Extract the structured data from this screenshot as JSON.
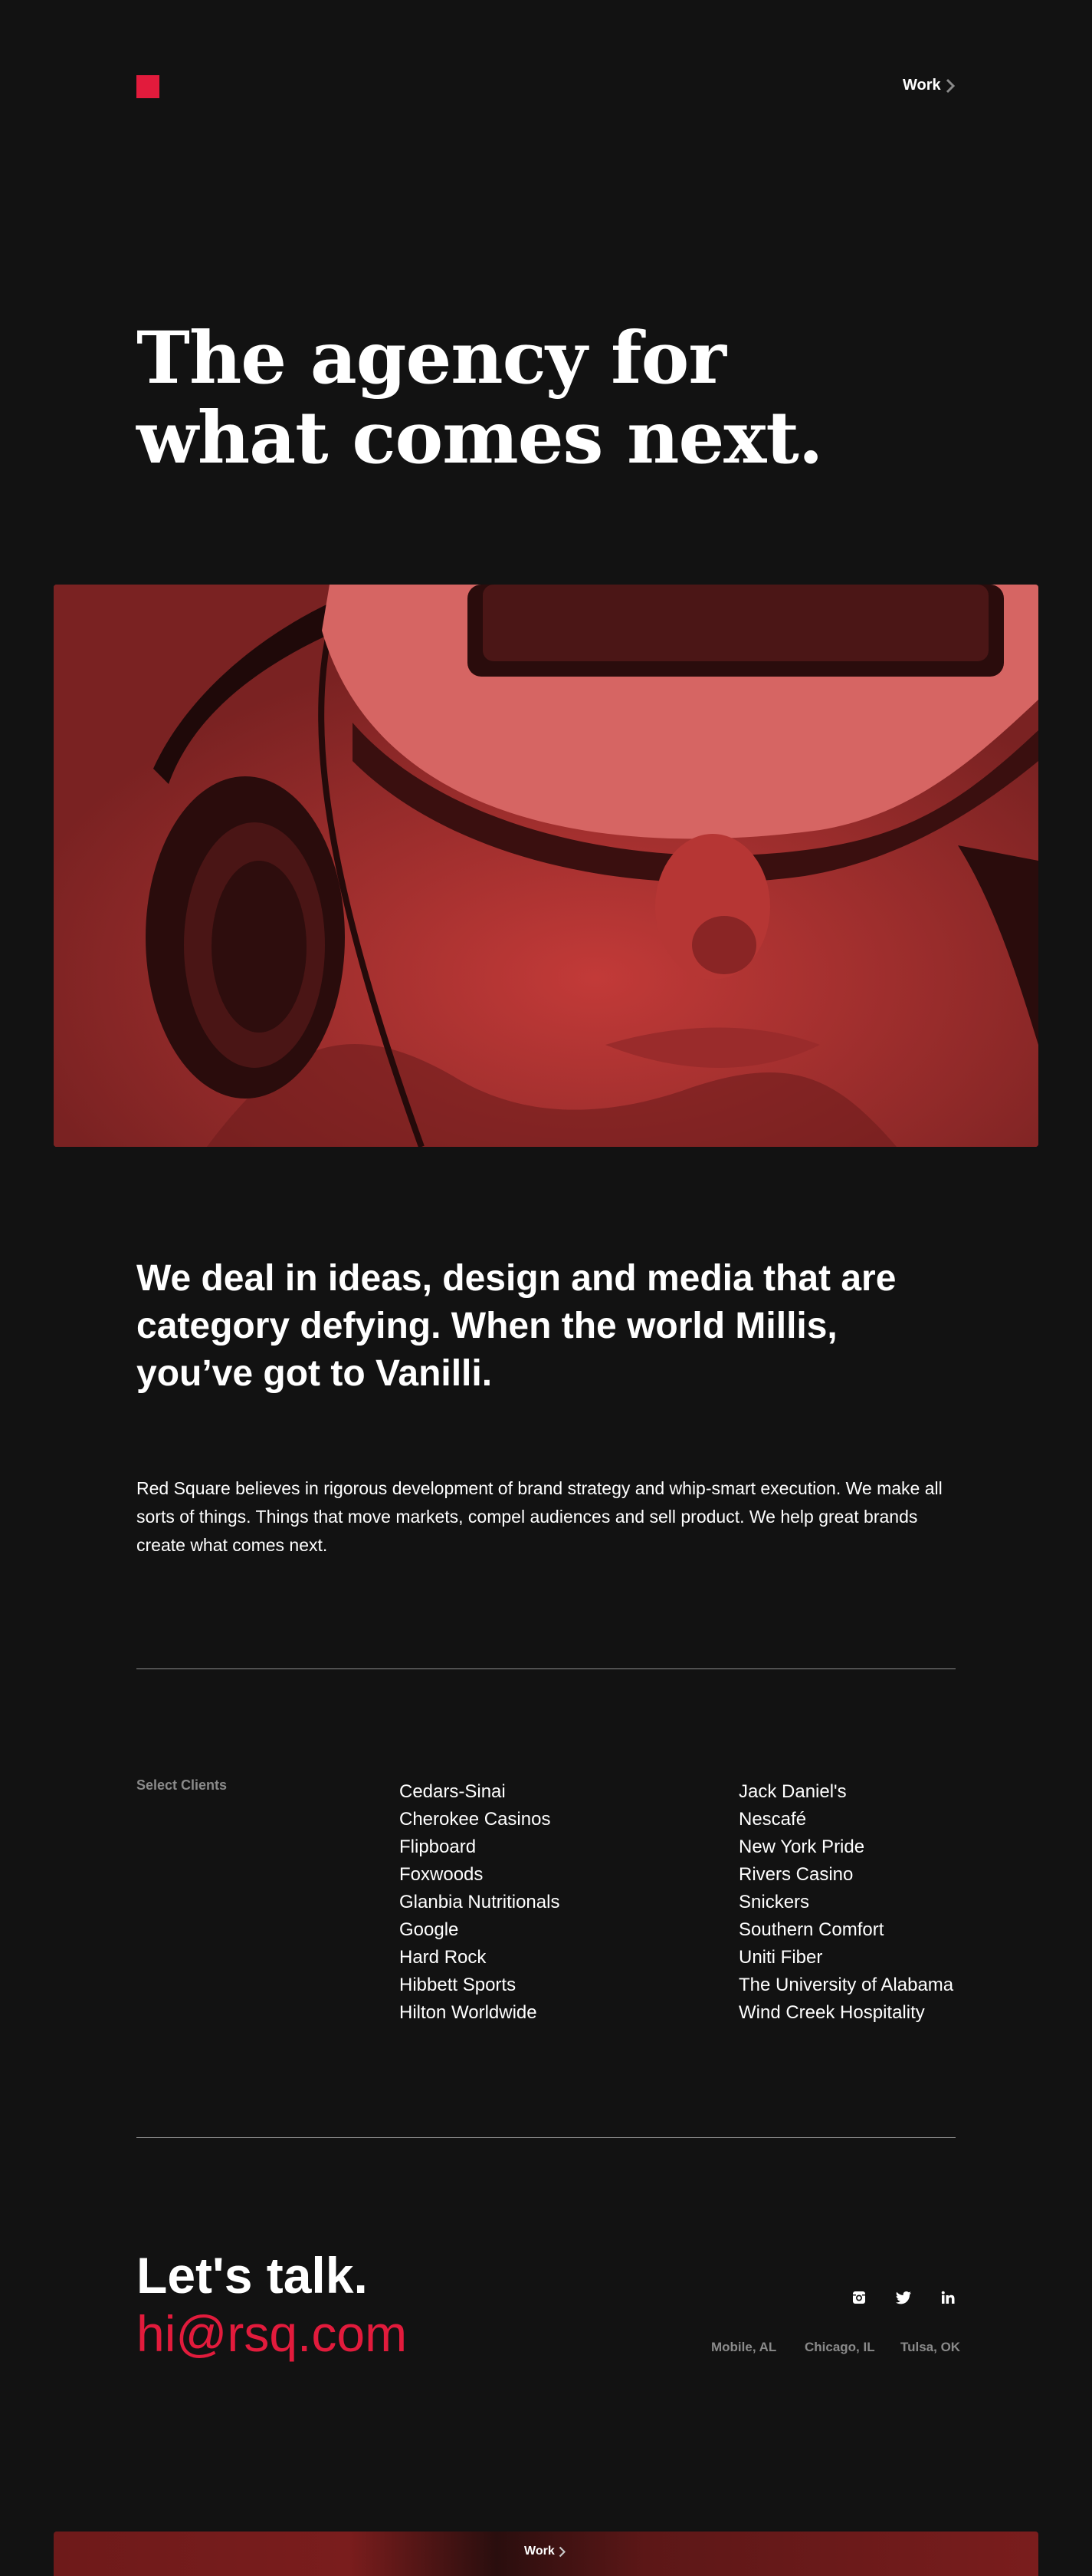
{
  "header": {
    "nav_work_label": "Work"
  },
  "hero": {
    "title_line1": "The agency for",
    "title_line2": "what comes next."
  },
  "intro": {
    "headline": "We deal in ideas, design and media that are category defying. When the world Millis, you’ve got to Vanilli.",
    "body": "Red Square believes in rigorous development of brand strategy and whip-smart execution. We make all sorts of things. Things that move markets, compel audiences and sell product. We help great brands create what comes next."
  },
  "clients": {
    "label": "Select Clients",
    "column1": [
      "Cedars-Sinai",
      "Cherokee Casinos",
      "Flipboard",
      "Foxwoods",
      "Glanbia Nutritionals",
      "Google",
      "Hard Rock",
      "Hibbett Sports",
      "Hilton Worldwide"
    ],
    "column2": [
      "Jack Daniel's",
      "Nescafé",
      "New York Pride",
      "Rivers Casino",
      "Snickers",
      "Southern Comfort",
      "Uniti Fiber",
      "The University of Alabama",
      "Wind Creek Hospitality"
    ]
  },
  "contact": {
    "title": "Let's talk.",
    "email": "hi@rsq.com",
    "social": [
      "instagram-icon",
      "twitter-icon",
      "linkedin-icon"
    ],
    "offices": [
      "Mobile, AL",
      "Chicago, IL",
      "Tulsa, OK"
    ]
  },
  "footer": {
    "work_label": "Work"
  },
  "colors": {
    "accent": "#e21b3c",
    "background": "#121212",
    "muted": "#8a8a8a"
  }
}
